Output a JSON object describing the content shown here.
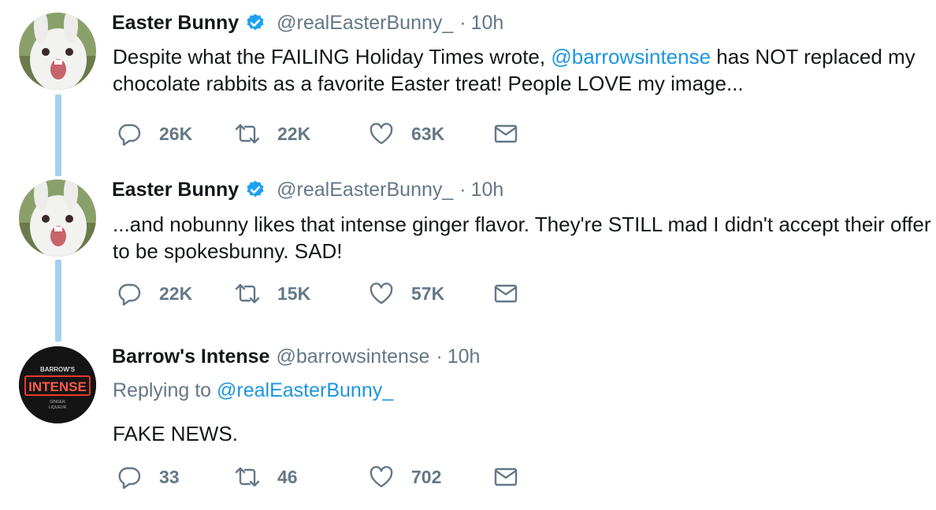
{
  "tweets": [
    {
      "name": "Easter Bunny",
      "handle": "@realEasterBunny_",
      "time": "10h",
      "text_before": "Despite what the FAILING Holiday Times wrote, ",
      "mention": "@barrowsintense",
      "text_after": " has NOT replaced my chocolate rabbits as a favorite Easter treat! People LOVE my image...",
      "replies": "26K",
      "retweets": "22K",
      "likes": "63K"
    },
    {
      "name": "Easter Bunny",
      "handle": "@realEasterBunny_",
      "time": "10h",
      "text": "...and nobunny likes that intense ginger flavor. They're STILL mad I didn't accept their offer to be spokesbunny. SAD!",
      "replies": "22K",
      "retweets": "15K",
      "likes": "57K"
    },
    {
      "name": "Barrow's Intense",
      "handle": "@barrowsintense",
      "time": "10h",
      "replying_prefix": "Replying to ",
      "replying_to": "@realEasterBunny_",
      "text": "FAKE NEWS.",
      "replies": "33",
      "retweets": "46",
      "likes": "702",
      "logo": {
        "top": "BARROW'S",
        "main": "INTENSE",
        "sub1": "GINGER",
        "sub2": "LIQUEUR"
      }
    }
  ],
  "colors": {
    "accent": "#1b95e0",
    "muted": "#657786",
    "thread_line": "#a5d0f0",
    "logo_red": "#e6392d"
  },
  "icons": [
    "verified-badge-icon",
    "reply-icon",
    "retweet-icon",
    "like-icon",
    "direct-message-icon"
  ]
}
